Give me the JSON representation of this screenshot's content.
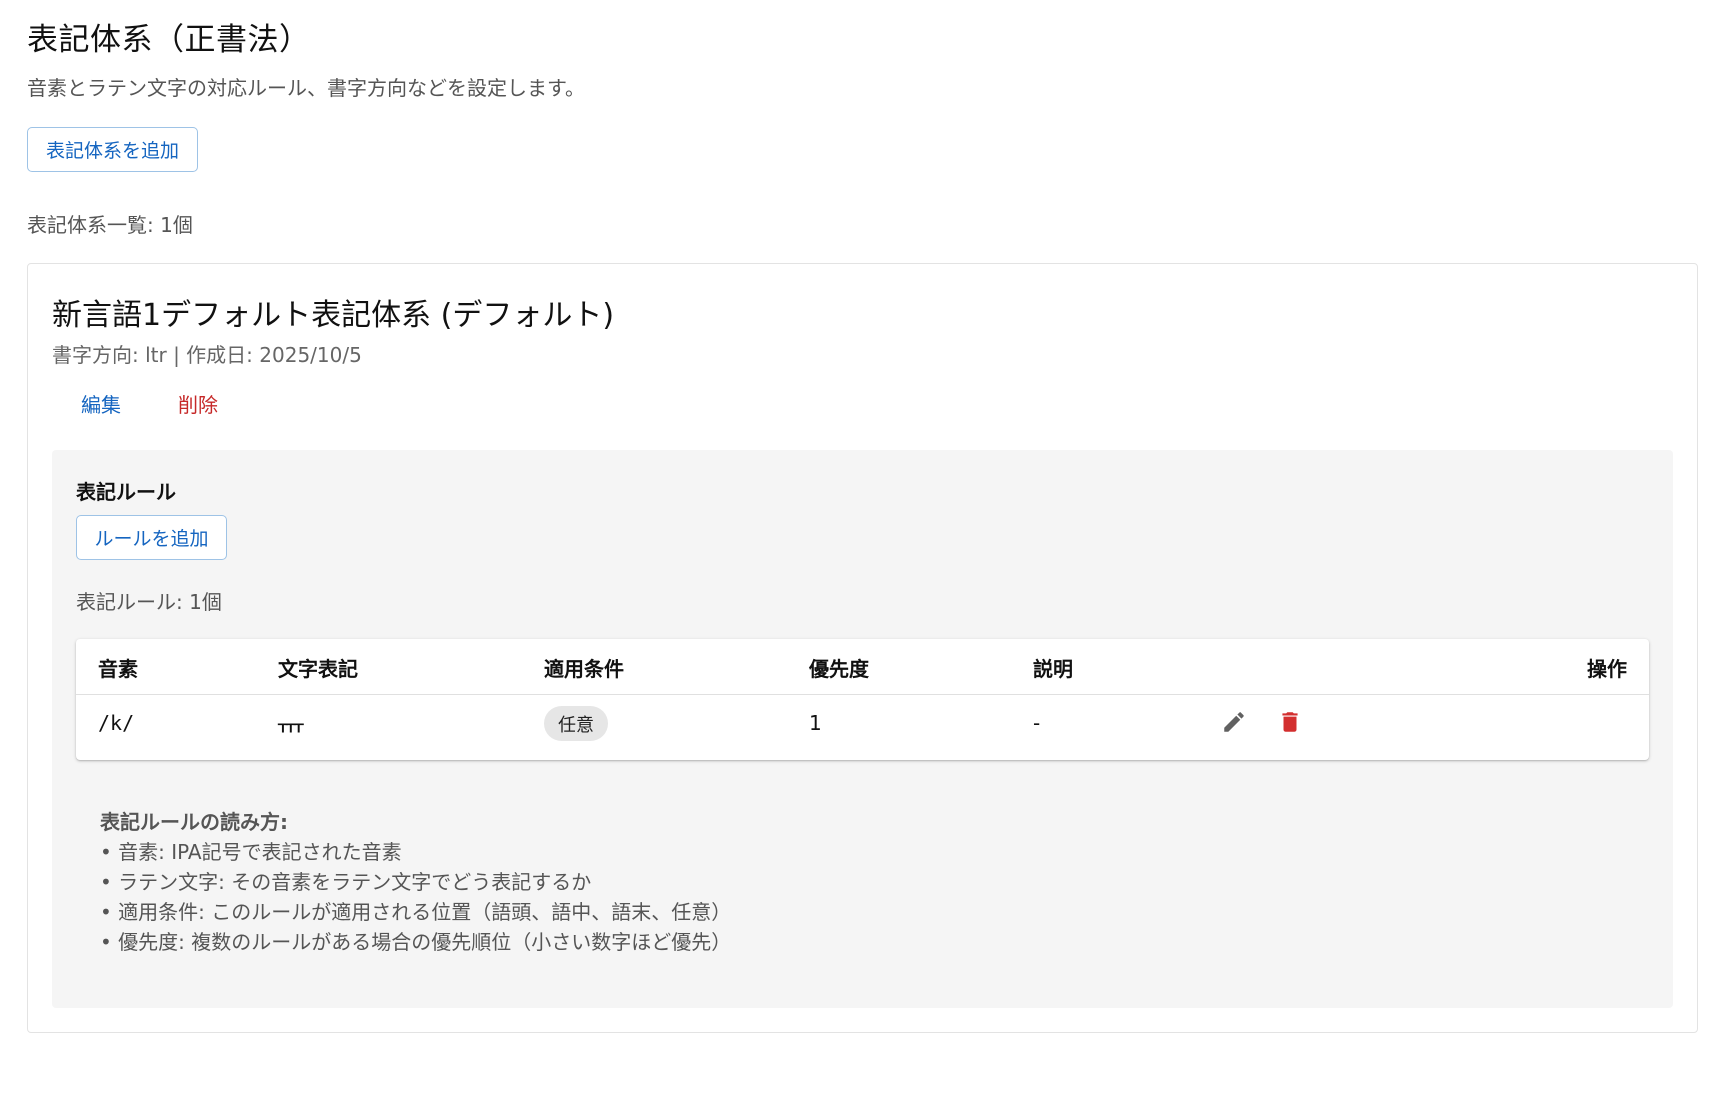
{
  "header": {
    "title": "表記体系（正書法）",
    "description": "音素とラテン文字の対応ルール、書字方向などを設定します。",
    "add_button": "表記体系を追加",
    "list_count": "表記体系一覧: 1個"
  },
  "system": {
    "title": "新言語1デフォルト表記体系 (デフォルト)",
    "meta": "書字方向: ltr | 作成日: 2025/10/5",
    "edit_label": "編集",
    "delete_label": "削除",
    "rules": {
      "heading": "表記ルール",
      "add_button": "ルールを追加",
      "count": "表記ルール: 1個",
      "columns": [
        "音素",
        "文字表記",
        "適用条件",
        "優先度",
        "説明",
        "操作"
      ],
      "rows": [
        {
          "phoneme": "/k/",
          "spelling": "ᚁᚁᚁ",
          "condition": "任意",
          "priority": "1",
          "description": "-"
        }
      ]
    },
    "guide": {
      "heading": "表記ルールの読み方:",
      "lines": [
        "• 音素: IPA記号で表記された音素",
        "• ラテン文字: その音素をラテン文字でどう表記するか",
        "• 適用条件: このルールが適用される位置（語頭、語中、語末、任意）",
        "• 優先度: 複数のルールがある場合の優先順位（小さい数字ほど優先）"
      ]
    }
  },
  "colors": {
    "primary": "#1565c0",
    "danger": "#d32f2f",
    "icon_gray": "#616161"
  },
  "icons": {
    "edit": "pencil-icon",
    "delete": "trash-icon"
  }
}
